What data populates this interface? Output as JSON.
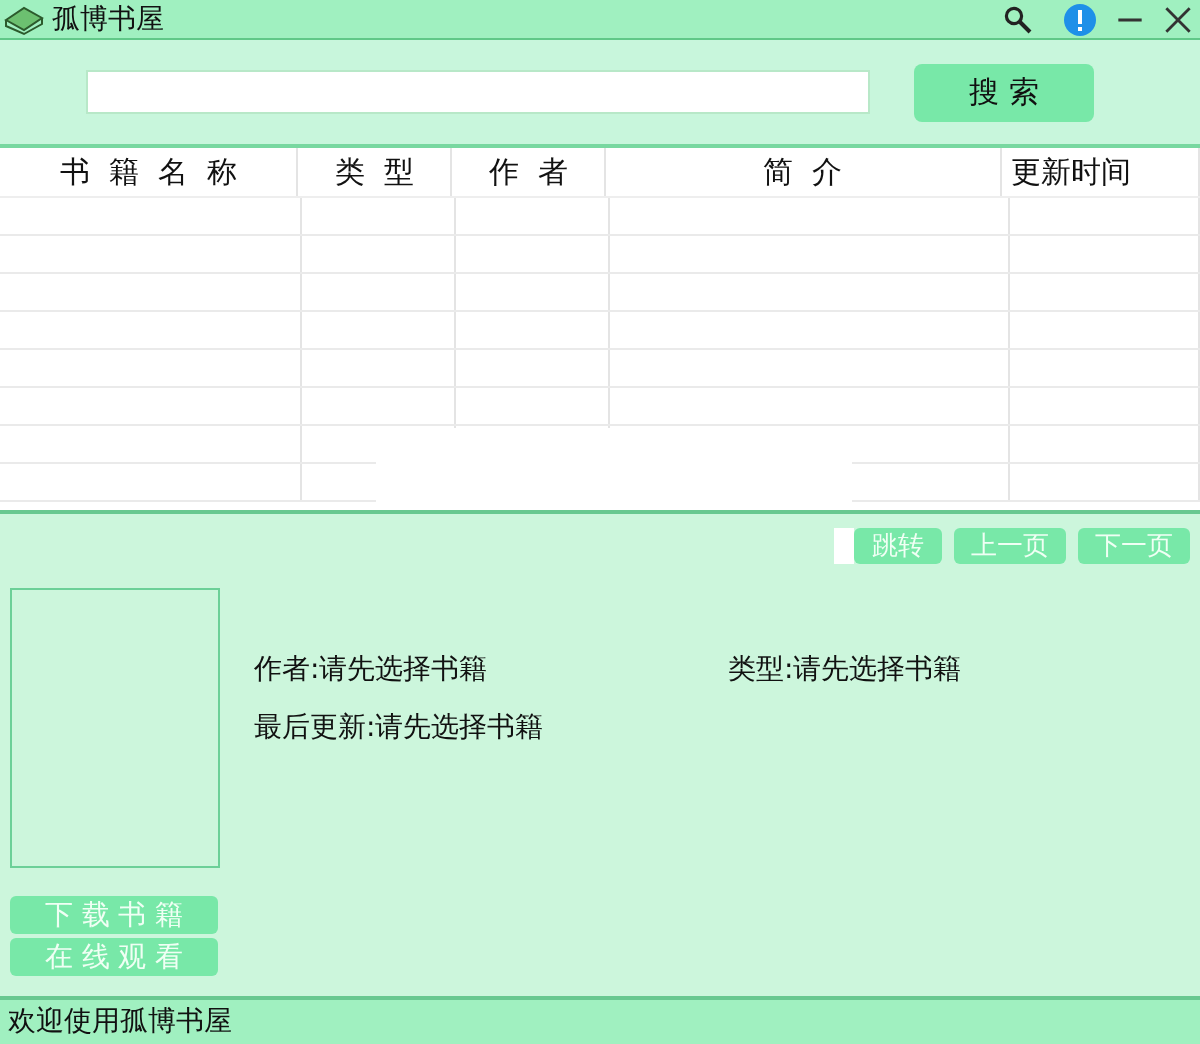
{
  "window": {
    "title": "孤博书屋"
  },
  "search": {
    "button": "搜 索"
  },
  "table": {
    "columns": [
      "书  籍  名  称",
      "类  型",
      "作  者",
      "简  介",
      "更新时间"
    ]
  },
  "pagination": {
    "buttons": [
      {
        "label": "跳转",
        "disabled": true
      },
      {
        "label": "上一页",
        "disabled": true
      },
      {
        "label": "下一页",
        "disabled": true
      }
    ]
  },
  "details": {
    "fields": [
      {
        "label": "作者:",
        "value": "请先选择书籍"
      },
      {
        "label": "类型:",
        "value": "请先选择书籍"
      },
      {
        "label": "最后更新:",
        "value": "请先选择书籍"
      }
    ],
    "actions": [
      {
        "label": "下 载 书 籍",
        "disabled": true
      },
      {
        "label": "在 线 观 看",
        "disabled": true
      }
    ]
  },
  "status_bar": "欢迎使用孤博书屋"
}
